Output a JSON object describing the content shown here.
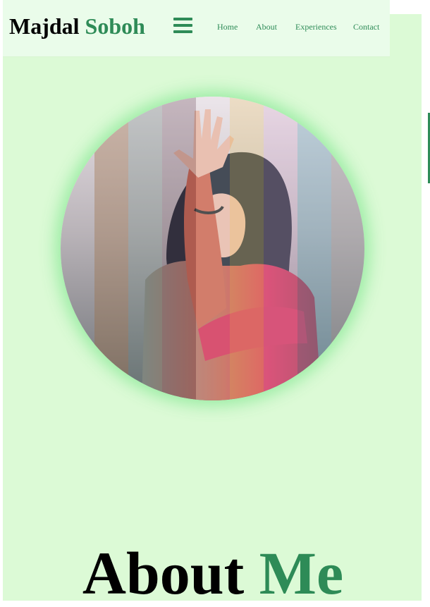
{
  "brand": {
    "first": "Majdal",
    "second": "Soboh"
  },
  "nav": {
    "menu_icon": "hamburger-menu-icon",
    "links": [
      "Home",
      "About",
      "Experiences",
      "Contact"
    ]
  },
  "colors": {
    "accent": "#2e8b57",
    "page_background": "#dcfad6",
    "navbar_background": "#eafcea"
  },
  "about": {
    "word1": "About",
    "word2": "Me"
  }
}
